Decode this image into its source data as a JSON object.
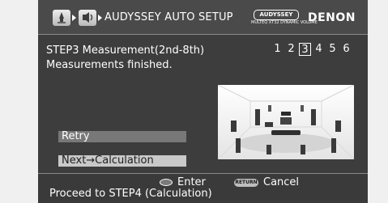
{
  "header": {
    "title": "AUDYSSEY AUTO SETUP",
    "logo_text": "AUDYSSEY",
    "logo_sub": "MULTEQ XT32 DYNAMIC VOLUME",
    "brand": "DENON",
    "nav_icons": [
      "speaker-setup-icon",
      "audyssey-icon"
    ]
  },
  "step": {
    "title": "STEP3 Measurement(2nd-8th)",
    "status": "Measurements finished.",
    "positions": [
      "1",
      "2",
      "3",
      "4",
      "5",
      "6"
    ],
    "current_position": "3"
  },
  "menu": {
    "items": [
      {
        "label": "Retry"
      },
      {
        "label": "Next→Calculation"
      }
    ],
    "selected_item": "Next→Calculation"
  },
  "footer": {
    "enter_label": "Enter",
    "return_badge": "RETURN",
    "cancel_label": "Cancel",
    "hint": "Proceed to STEP4 (Calculation)"
  },
  "colors": {
    "panel": "#3d3d3d",
    "header": "#4a4a4a",
    "menu_item": "#787878",
    "menu_item_selected": "#c9c9c9",
    "image_background": "#f3f3f3"
  }
}
